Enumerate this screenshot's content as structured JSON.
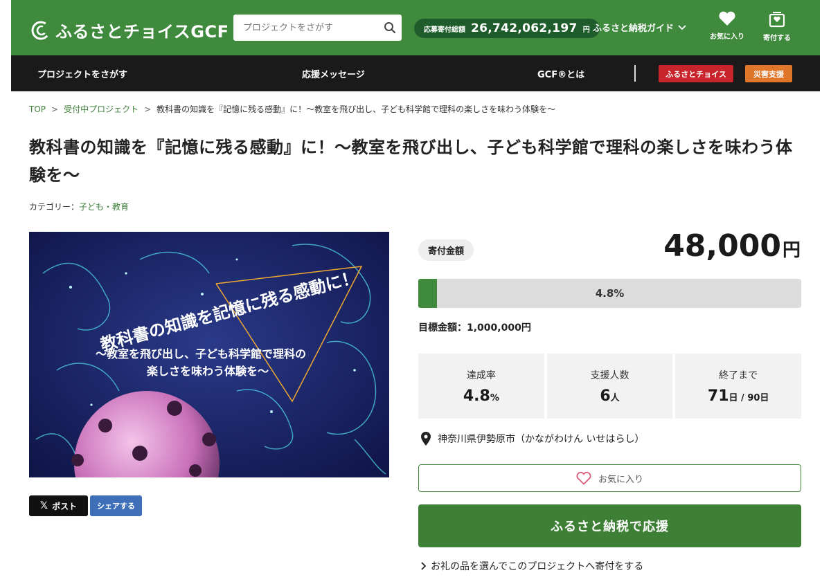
{
  "header": {
    "logo_text": "ふるさとチョイスGCF",
    "search_placeholder": "プロジェクトをさがす",
    "total_label": "応募寄付総額",
    "total_value": "26,742,062,197",
    "total_unit": "円",
    "guide_label": "ふるさと納税ガイド",
    "favorites_label": "お気に入り",
    "donate_label": "寄付する"
  },
  "nav": {
    "find_projects": "プロジェクトをさがす",
    "messages": "応援メッセージ",
    "about": "GCF®とは",
    "furusato_choice": "ふるさとチョイス",
    "disaster": "災害支援",
    "furusato_color": "#c8242b",
    "disaster_color": "#e0762a"
  },
  "breadcrumb": {
    "top": "TOP",
    "projects": "受付中プロジェクト",
    "current": "教科書の知識を『記憶に残る感動』に！～教室を飛び出し、子ども科学館で理科の楽しさを味わう体験を～"
  },
  "project": {
    "title": "教科書の知識を『記憶に残る感動』に！～教室を飛び出し、子ども科学館で理科の楽しさを味わう体験を～",
    "category_label": "カテゴリー：",
    "category_value": "子ども・教育"
  },
  "hero": {
    "line1": "教科書の知識を記憶に残る感動に！",
    "line2": "～教室を飛び出し、子ども科学館で理科の",
    "line3": "楽しさを味わう体験を～"
  },
  "share": {
    "x_label": "ポスト",
    "facebook_label": "シェアする"
  },
  "funding": {
    "amount_label": "寄付金額",
    "amount_value": "48,000",
    "amount_unit": "円",
    "progress_percent": 4.8,
    "progress_text": "4.8%",
    "goal_text": "目標金額：1,000,000円",
    "accent_color": "#3f8a3c"
  },
  "stats": {
    "rate_label": "達成率",
    "rate_value": "4.8",
    "rate_unit": "%",
    "supporters_label": "支援人数",
    "supporters_value": "6",
    "supporters_unit": "人",
    "remaining_label": "終了まで",
    "remaining_value": "71",
    "remaining_unit": "日 / 90日"
  },
  "location": {
    "text": "神奈川県伊勢原市（かながわけん いせはらし）"
  },
  "actions": {
    "favorite_label": "お気に入り",
    "support_label": "ふるさと納税で応援",
    "gift_link": "お礼の品を選んでこのプロジェクトへ寄付をする"
  }
}
